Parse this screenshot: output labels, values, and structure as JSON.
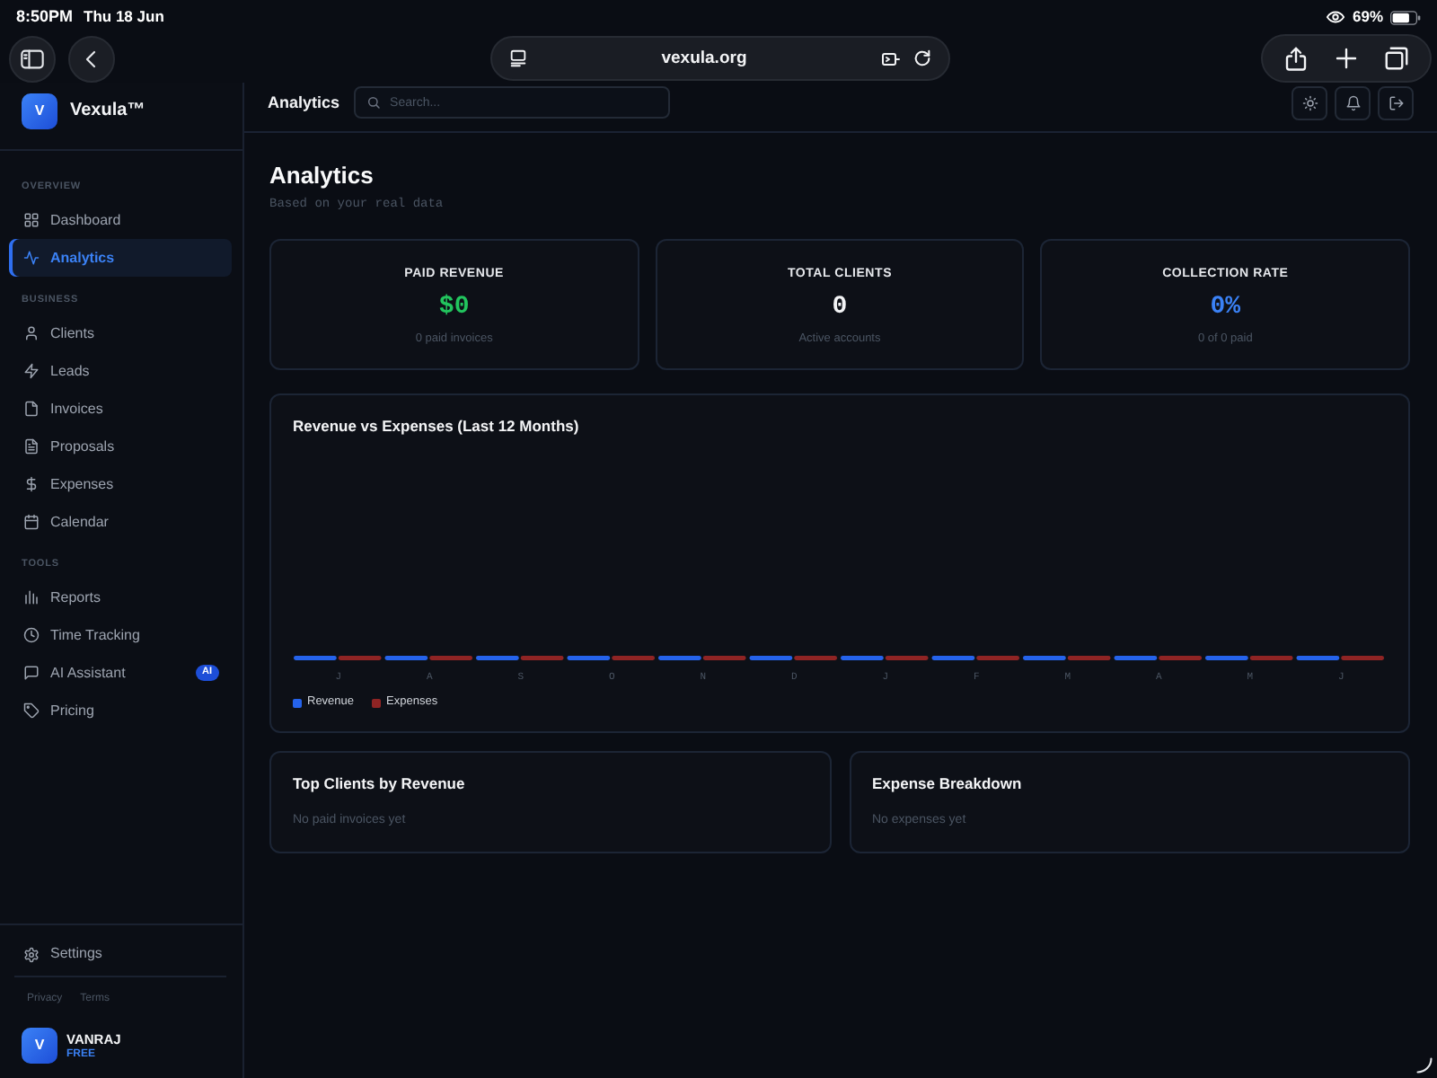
{
  "status_bar": {
    "time": "8:50PM",
    "date": "Thu 18 Jun",
    "battery": "69%"
  },
  "browser": {
    "url": "vexula.org"
  },
  "sidebar": {
    "brand": {
      "initial": "V",
      "name": "Vexula™"
    },
    "sections": [
      {
        "heading": "OVERVIEW",
        "items": [
          {
            "label": "Dashboard",
            "selected": false
          },
          {
            "label": "Analytics",
            "selected": true
          }
        ]
      },
      {
        "heading": "BUSINESS",
        "items": [
          {
            "label": "Clients",
            "selected": false
          },
          {
            "label": "Leads",
            "selected": false
          },
          {
            "label": "Invoices",
            "selected": false
          },
          {
            "label": "Proposals",
            "selected": false
          },
          {
            "label": "Expenses",
            "selected": false
          },
          {
            "label": "Calendar",
            "selected": false
          }
        ]
      },
      {
        "heading": "TOOLS",
        "items": [
          {
            "label": "Reports",
            "selected": false
          },
          {
            "label": "Time Tracking",
            "selected": false
          },
          {
            "label": "AI Assistant",
            "selected": false,
            "badge": "AI"
          },
          {
            "label": "Pricing",
            "selected": false
          }
        ]
      }
    ],
    "settings": "Settings",
    "footer_links": [
      "Privacy",
      "Terms"
    ],
    "user": {
      "initial": "V",
      "name": "VANRAJ",
      "plan": "FREE"
    }
  },
  "header": {
    "title": "Analytics",
    "search": {
      "placeholder": "Search..."
    }
  },
  "page": {
    "title": "Analytics",
    "subtitle": "Based on your real data"
  },
  "stats": [
    {
      "label": "PAID REVENUE",
      "value": "$0",
      "note": "0 paid invoices",
      "color": "#22c55e"
    },
    {
      "label": "TOTAL CLIENTS",
      "value": "0",
      "note": "Active accounts",
      "color": "#f3f4f6"
    },
    {
      "label": "COLLECTION RATE",
      "value": "0%",
      "note": "0 of 0 paid",
      "color": "#3b82f6"
    }
  ],
  "chart": {
    "title": "Revenue vs Expenses (Last 12 Months)",
    "months": [
      "J",
      "A",
      "S",
      "O",
      "N",
      "D",
      "J",
      "F",
      "M",
      "A",
      "M",
      "J"
    ],
    "legend": [
      {
        "label": "Revenue",
        "color": "#2563eb"
      },
      {
        "label": "Expenses",
        "color": "#8f2424"
      }
    ]
  },
  "panels": [
    {
      "title": "Top Clients by Revenue",
      "empty_text": "No paid invoices yet"
    },
    {
      "title": "Expense Breakdown",
      "empty_text": "No expenses yet"
    }
  ]
}
